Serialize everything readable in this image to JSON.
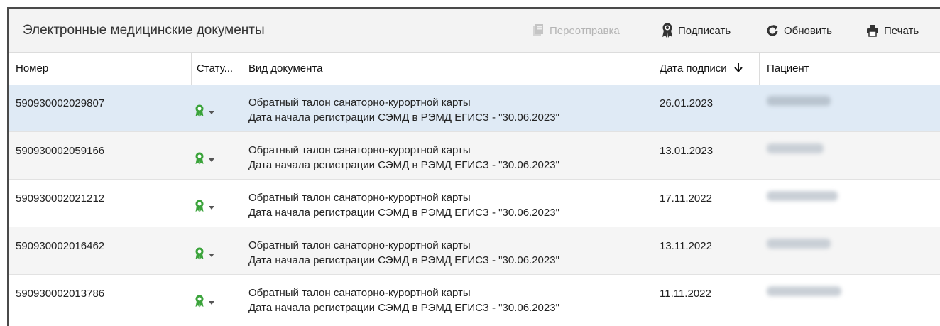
{
  "toolbar": {
    "title": "Электронные медицинские документы",
    "resend_label": "Переотправка",
    "sign_label": "Подписать",
    "refresh_label": "Обновить",
    "print_label": "Печать"
  },
  "columns": {
    "number": "Номер",
    "status": "Стату...",
    "doc_type": "Вид документа",
    "sign_date": "Дата подписи",
    "patient": "Пациент"
  },
  "rows": [
    {
      "number": "590930002029807",
      "doc_line1": "Обратный талон санаторно-курортной карты",
      "doc_line2": "Дата начала регистрации СЭМД в РЭМД ЕГИСЗ - \"30.06.2023\"",
      "date": "26.01.2023",
      "status_icon": "signed-badge-icon",
      "selected": true
    },
    {
      "number": "590930002059166",
      "doc_line1": "Обратный талон санаторно-курортной карты",
      "doc_line2": "Дата начала регистрации СЭМД в РЭМД ЕГИСЗ - \"30.06.2023\"",
      "date": "13.01.2023",
      "status_icon": "signed-badge-icon",
      "selected": false
    },
    {
      "number": "590930002021212",
      "doc_line1": "Обратный талон санаторно-курортной карты",
      "doc_line2": "Дата начала регистрации СЭМД в РЭМД ЕГИСЗ - \"30.06.2023\"",
      "date": "17.11.2022",
      "status_icon": "signed-badge-icon",
      "selected": false
    },
    {
      "number": "590930002016462",
      "doc_line1": "Обратный талон санаторно-курортной карты",
      "doc_line2": "Дата начала регистрации СЭМД в РЭМД ЕГИСЗ - \"30.06.2023\"",
      "date": "13.11.2022",
      "status_icon": "signed-badge-icon",
      "selected": false
    },
    {
      "number": "590930002013786",
      "doc_line1": "Обратный талон санаторно-курортной карты",
      "doc_line2": "Дата начала регистрации СЭМД в РЭМД ЕГИСЗ - \"30.06.2023\"",
      "date": "11.11.2022",
      "status_icon": "signed-badge-icon",
      "selected": false
    }
  ],
  "colors": {
    "status_green": "#3aa33a",
    "selected_row": "#dfeaf5",
    "toolbar_bg": "#f3f3f3"
  }
}
